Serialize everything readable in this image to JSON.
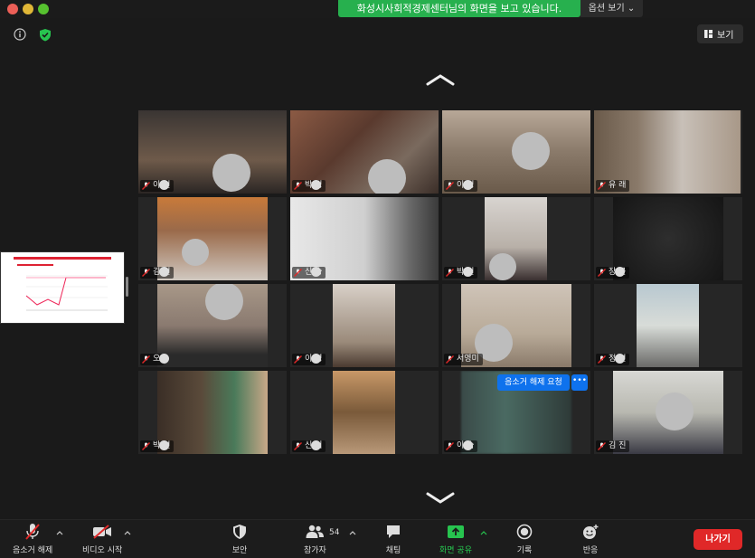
{
  "window": {
    "share_banner": "화성시사회적경제센터님의 화면을 보고 있습니다.",
    "view_options": "옵션 보기"
  },
  "top": {
    "view_label": "보기"
  },
  "gallery": {
    "participants": [
      {
        "name": "이 현",
        "row": 0,
        "col": 0
      },
      {
        "name": "박 정",
        "row": 0,
        "col": 1
      },
      {
        "name": "이 정",
        "row": 0,
        "col": 2
      },
      {
        "name": "유 래",
        "row": 0,
        "col": 3
      },
      {
        "name": "김 현",
        "row": 1,
        "col": 0
      },
      {
        "name": "신 승",
        "row": 1,
        "col": 1
      },
      {
        "name": "박 원",
        "row": 1,
        "col": 2
      },
      {
        "name": "장 곤",
        "row": 1,
        "col": 3
      },
      {
        "name": "오",
        "row": 2,
        "col": 0
      },
      {
        "name": "이 영",
        "row": 2,
        "col": 1
      },
      {
        "name": "서영미",
        "row": 2,
        "col": 2
      },
      {
        "name": "정 연",
        "row": 2,
        "col": 3
      },
      {
        "name": "박 연",
        "row": 3,
        "col": 0
      },
      {
        "name": "신 이",
        "row": 3,
        "col": 1
      },
      {
        "name": "이 숙",
        "row": 3,
        "col": 2
      },
      {
        "name": "김 진",
        "row": 3,
        "col": 3
      }
    ],
    "unmute_request_label": "음소거 해제 요청",
    "more_label": "•••"
  },
  "toolbar": {
    "unmute_label": "음소거 해제",
    "start_video_label": "비디오 시작",
    "security_label": "보안",
    "participants_label": "참가자",
    "participants_count": "54",
    "chat_label": "채팅",
    "share_screen_label": "화면 공유",
    "record_label": "기록",
    "reactions_label": "반응",
    "leave_label": "나가기"
  },
  "colors": {
    "share_green": "#27b04e",
    "leave_red": "#e02828",
    "unmute_blue": "#0e72ed",
    "muted_red": "#e02828"
  }
}
